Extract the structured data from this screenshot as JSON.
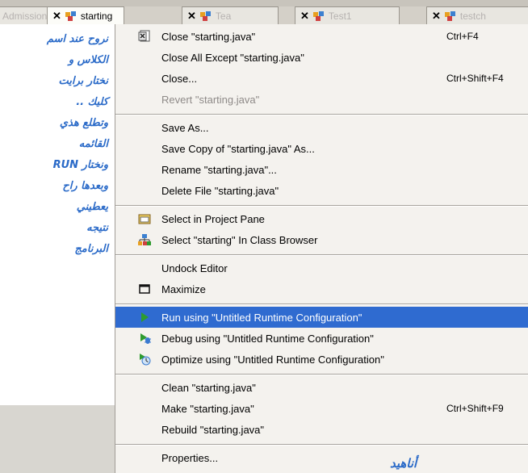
{
  "tabs": [
    {
      "label": "Admission",
      "close": ""
    },
    {
      "label": "starting",
      "close": "✕"
    },
    {
      "label": "Tea",
      "close": "✕"
    },
    {
      "label": "Test1",
      "close": "✕"
    },
    {
      "label": "testch",
      "close": "✕"
    }
  ],
  "annotation_lines": [
    "نروح عند اسم",
    "الكلاس و",
    "نختار برايت",
    "كليك ..",
    "وتطلع هذي",
    "القائمه",
    "ونختار RUN",
    "وبعدها راح",
    "يعطيني",
    "نتيجه",
    "البرنامج"
  ],
  "signature": "أناهيد",
  "menu": {
    "close": {
      "label": "Close \"starting.java\"",
      "shortcut": "Ctrl+F4"
    },
    "close_all_except": {
      "label": "Close All Except \"starting.java\""
    },
    "close_dots": {
      "label": "Close...",
      "shortcut": "Ctrl+Shift+F4"
    },
    "revert": {
      "label": "Revert \"starting.java\""
    },
    "save_as": {
      "label": "Save As..."
    },
    "save_copy": {
      "label": "Save Copy of \"starting.java\" As..."
    },
    "rename": {
      "label": "Rename \"starting.java\"..."
    },
    "delete": {
      "label": "Delete File \"starting.java\""
    },
    "select_project": {
      "label": "Select in Project Pane"
    },
    "select_class": {
      "label": "Select \"starting\" In Class Browser"
    },
    "undock": {
      "label": "Undock Editor"
    },
    "maximize": {
      "label": "Maximize"
    },
    "run": {
      "label": "Run using \"Untitled Runtime Configuration\""
    },
    "debug": {
      "label": "Debug using \"Untitled Runtime Configuration\""
    },
    "optimize": {
      "label": "Optimize using \"Untitled Runtime Configuration\""
    },
    "clean": {
      "label": "Clean \"starting.java\""
    },
    "make": {
      "label": "Make \"starting.java\"",
      "shortcut": "Ctrl+Shift+F9"
    },
    "rebuild": {
      "label": "Rebuild \"starting.java\""
    },
    "properties": {
      "label": "Properties..."
    }
  },
  "colors": {
    "highlight": "#2f6bd0",
    "annotation": "#2a6ac8",
    "run_icon": "#2e9b2e"
  }
}
